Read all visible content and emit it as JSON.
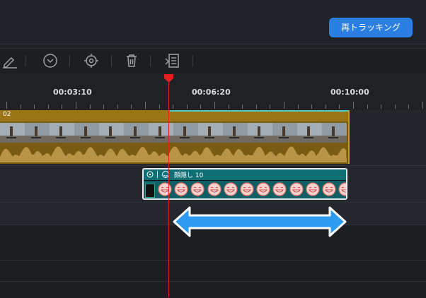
{
  "header": {
    "retrack_label": "再トラッキング"
  },
  "toolbar": {
    "icons": [
      "pen-icon",
      "chevron-down-circle-icon",
      "target-icon",
      "trash-icon",
      "edit-list-icon"
    ]
  },
  "ruler": {
    "times": [
      "00:03:10",
      "00:06:20",
      "00:10:00"
    ]
  },
  "video_clip": {
    "label": "02"
  },
  "mosaic_clip": {
    "label": "顔隠し 10",
    "face_icon": "laughing-face-icon"
  },
  "colors": {
    "accent": "#2b7fe3",
    "playhead": "#e0231f",
    "video_clip": "#9a7415",
    "mosaic_clip": "#0e6f74",
    "arrow": "#2f9bf0"
  }
}
